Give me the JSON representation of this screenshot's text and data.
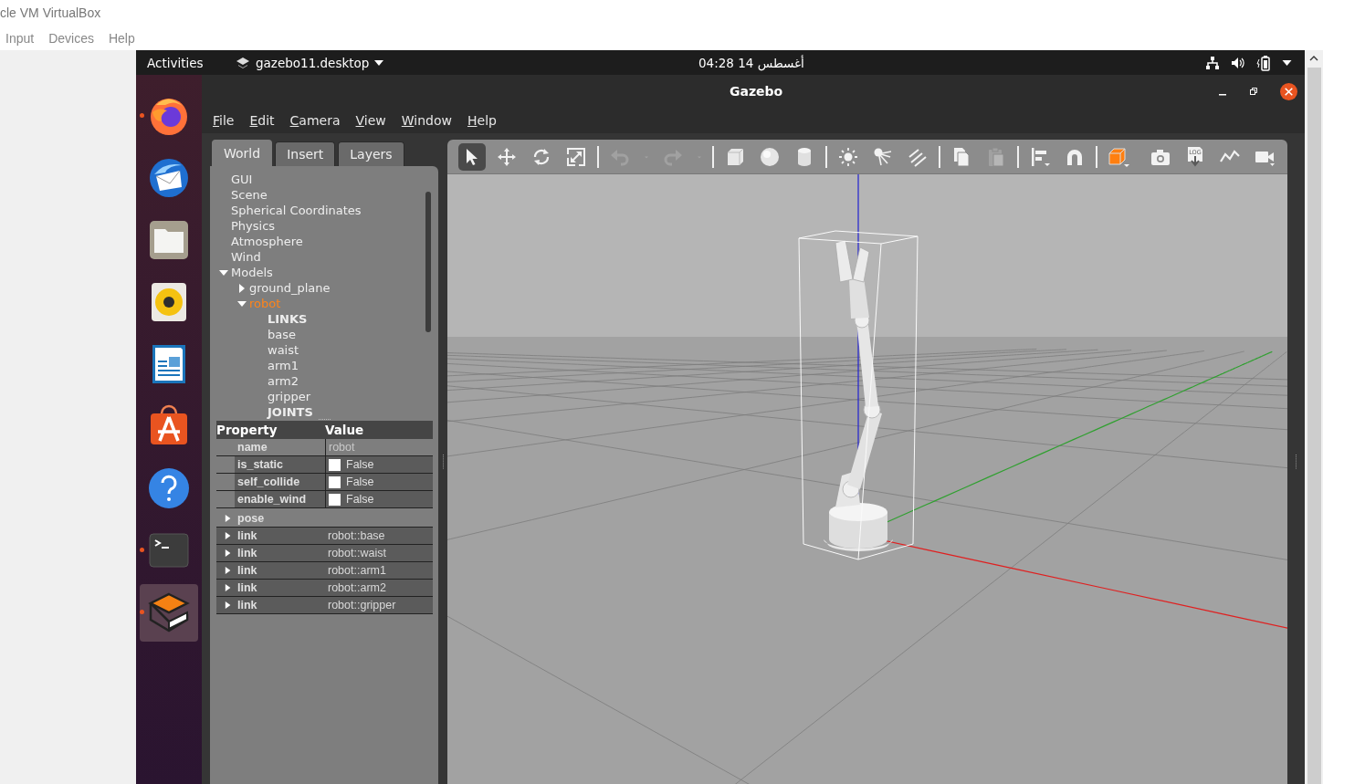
{
  "vbox": {
    "title": "cle VM VirtualBox",
    "menu": [
      "Input",
      "Devices",
      "Help"
    ]
  },
  "topbar": {
    "activities": "Activities",
    "app": "gazebo11.desktop",
    "clock": "04:28  14 أغسطس"
  },
  "dock": [
    {
      "kind": "browser",
      "running": true,
      "selected": false
    },
    {
      "kind": "mail",
      "running": false,
      "selected": false
    },
    {
      "kind": "files",
      "running": false,
      "selected": false
    },
    {
      "kind": "music",
      "running": false,
      "selected": false
    },
    {
      "kind": "writer",
      "running": false,
      "selected": false
    },
    {
      "kind": "store",
      "running": false,
      "selected": false
    },
    {
      "kind": "help",
      "running": false,
      "selected": false
    },
    {
      "kind": "terminal",
      "running": true,
      "selected": false
    },
    {
      "kind": "gazebo",
      "running": true,
      "selected": true
    }
  ],
  "window": {
    "title": "Gazebo",
    "menu": [
      "File",
      "Edit",
      "Camera",
      "View",
      "Window",
      "Help"
    ]
  },
  "tabs": [
    {
      "label": "World",
      "selected": true
    },
    {
      "label": "Insert",
      "selected": false
    },
    {
      "label": "Layers",
      "selected": false
    }
  ],
  "tree": [
    {
      "label": "GUI",
      "kind": "item",
      "selected": false
    },
    {
      "label": "Scene",
      "kind": "item",
      "selected": false
    },
    {
      "label": "Spherical Coordinates",
      "kind": "item",
      "selected": false
    },
    {
      "label": "Physics",
      "kind": "item",
      "selected": false
    },
    {
      "label": "Atmosphere",
      "kind": "item",
      "selected": false
    },
    {
      "label": "Wind",
      "kind": "item",
      "selected": false
    },
    {
      "label": "Models",
      "kind": "item",
      "selected": false,
      "expanded": true,
      "children": [
        {
          "label": "ground_plane",
          "kind": "item",
          "selected": false,
          "expanded": false
        },
        {
          "label": "robot",
          "kind": "item",
          "selected": true,
          "expanded": true,
          "children": [
            {
              "label": "LINKS",
              "kind": "header",
              "selected": false
            },
            {
              "label": "base",
              "kind": "item",
              "selected": false
            },
            {
              "label": "waist",
              "kind": "item",
              "selected": false
            },
            {
              "label": "arm1",
              "kind": "item",
              "selected": false
            },
            {
              "label": "arm2",
              "kind": "item",
              "selected": false
            },
            {
              "label": "gripper",
              "kind": "item",
              "selected": false
            },
            {
              "label": "JOINTS",
              "kind": "header",
              "selected": false
            }
          ]
        }
      ]
    }
  ],
  "properties": {
    "columns": [
      "Property",
      "Value"
    ],
    "rows": [
      {
        "kind": "text",
        "name": "name",
        "value": "robot"
      },
      {
        "kind": "check",
        "name": "is_static",
        "checked": false,
        "value": "False"
      },
      {
        "kind": "check",
        "name": "self_collide",
        "checked": false,
        "value": "False"
      },
      {
        "kind": "check",
        "name": "enable_wind",
        "checked": false,
        "value": "False"
      },
      {
        "kind": "group",
        "name": "pose",
        "expanded": false
      },
      {
        "kind": "group",
        "name": "link",
        "value": "robot::base",
        "expanded": false
      },
      {
        "kind": "group",
        "name": "link",
        "value": "robot::waist",
        "expanded": false
      },
      {
        "kind": "group",
        "name": "link",
        "value": "robot::arm1",
        "expanded": false
      },
      {
        "kind": "group",
        "name": "link",
        "value": "robot::arm2",
        "expanded": false
      },
      {
        "kind": "group",
        "name": "link",
        "value": "robot::gripper",
        "expanded": false
      }
    ]
  },
  "toolbar": {
    "groups": [
      [
        {
          "kind": "select",
          "selected": true,
          "disabled": false
        },
        {
          "kind": "translate",
          "selected": false,
          "disabled": false
        },
        {
          "kind": "rotate",
          "selected": false,
          "disabled": false
        },
        {
          "kind": "scale",
          "selected": false,
          "disabled": false
        }
      ],
      [
        {
          "kind": "undo",
          "disabled": true
        },
        {
          "kind": "dropdown",
          "disabled": true
        },
        {
          "kind": "redo",
          "disabled": true
        },
        {
          "kind": "dropdown",
          "disabled": true
        }
      ],
      [
        {
          "kind": "box",
          "disabled": false
        },
        {
          "kind": "sphere",
          "disabled": false
        },
        {
          "kind": "cylinder",
          "disabled": false
        }
      ],
      [
        {
          "kind": "point-light",
          "disabled": false
        },
        {
          "kind": "spot-light",
          "disabled": false
        },
        {
          "kind": "directional-light",
          "disabled": false
        }
      ],
      [
        {
          "kind": "copy",
          "disabled": false
        },
        {
          "kind": "paste",
          "disabled": true
        }
      ],
      [
        {
          "kind": "align",
          "disabled": false
        },
        {
          "kind": "snap",
          "disabled": false
        }
      ],
      [
        {
          "kind": "view-angle",
          "disabled": false
        }
      ]
    ],
    "right": [
      {
        "kind": "screenshot",
        "disabled": false
      },
      {
        "kind": "log",
        "label": "LOG",
        "disabled": false
      },
      {
        "kind": "plot",
        "disabled": false
      },
      {
        "kind": "video",
        "disabled": false
      }
    ]
  }
}
